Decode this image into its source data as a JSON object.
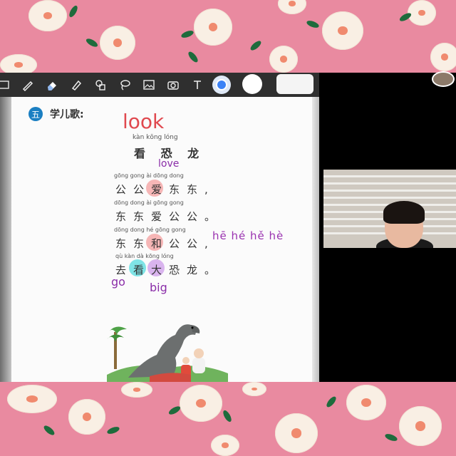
{
  "toolbar": {
    "tools": [
      "pen-icon",
      "eraser-icon",
      "highlighter-icon",
      "shapes-icon",
      "lasso-icon",
      "image-icon",
      "camera-icon",
      "text-icon"
    ],
    "colors": {
      "selected": "#3b82f6",
      "secondary": "#ffffff"
    }
  },
  "lesson": {
    "section_number": "五",
    "section_label": "学儿歌:",
    "title_pinyin": "kàn kōng lóng",
    "title": "看 恐 龙",
    "lines": [
      {
        "pinyin": "gōng gong  ài  dōng dong",
        "text": "公公爱东东,"
      },
      {
        "pinyin": "dōng dong  ài  gōng gong",
        "text": "东东爱公公。"
      },
      {
        "pinyin": "dōng dong  hé  gōng gong",
        "text": "东东和公公,"
      },
      {
        "pinyin": "qù   kàn  dà  kōng lóng",
        "text": "去看大恐龙。"
      }
    ]
  },
  "annotations": {
    "look": "look",
    "love": "love",
    "tones": "hē hé hě hè",
    "go": "go",
    "big": "big"
  },
  "colors": {
    "background": "#e98aa0",
    "ink_red": "#e0494f",
    "ink_purple": "#8a2da8",
    "highlight_pink": "#f6b6b6",
    "highlight_cyan": "#7fe4e6",
    "highlight_lilac": "#d9b4ee"
  }
}
